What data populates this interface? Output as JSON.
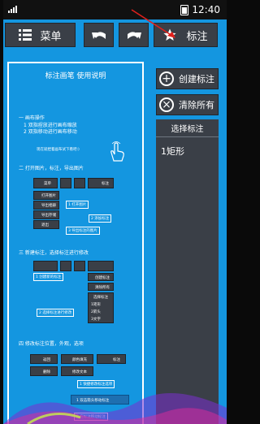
{
  "statusbar": {
    "time": "12:40"
  },
  "toolbar": {
    "menu_label": "菜单",
    "mark_label": "标注"
  },
  "right_panel": {
    "create_label": "创建标注",
    "clear_label": "清除所有",
    "list_title": "选择标注",
    "items": [
      "1矩形"
    ]
  },
  "guide": {
    "title": "标注画笔 使用说明",
    "s1_head": "一  画布操作",
    "s1_l1": "1 双指捏放进行画布缩放",
    "s1_l2": "2 双指移动进行画布移动",
    "s1_tip": "现在就捏着画布试下看吧:)",
    "s2_head": "二  打开图片，标注，导出图片",
    "s2_menu": "菜单",
    "s2_mark": "标注",
    "s2_open": "打开图片",
    "s2_import": "导出相册",
    "s2_export": "导出存储",
    "s2_exit": "退出",
    "s2_c1": "1 打开图片",
    "s2_c2": "2 添加标注",
    "s2_c3": "3 导出标注的图片",
    "s3_head": "三  新建标注，选择标注进行修改",
    "s3_c1": "1 创建新的标注",
    "s3_create": "创建标注",
    "s3_clear": "清除所有",
    "s3_select": "选择标注",
    "s3_i1": "1矩形",
    "s3_i2": "2箭头",
    "s3_i3": "3文字",
    "s3_c2": "2 选择标注进行修改",
    "s4_head": "四  修改标注位置，外观，选项",
    "s4_back": "返回",
    "s4_color": "颜色填充",
    "s4_mark": "标注",
    "s4_delete": "删除",
    "s4_text": "修改文本",
    "s4_c1": "1 快捷修改标注选项",
    "s4_c2": "1 双击箭头移动标注",
    "s4_c3": "2 在标注移动标注"
  }
}
